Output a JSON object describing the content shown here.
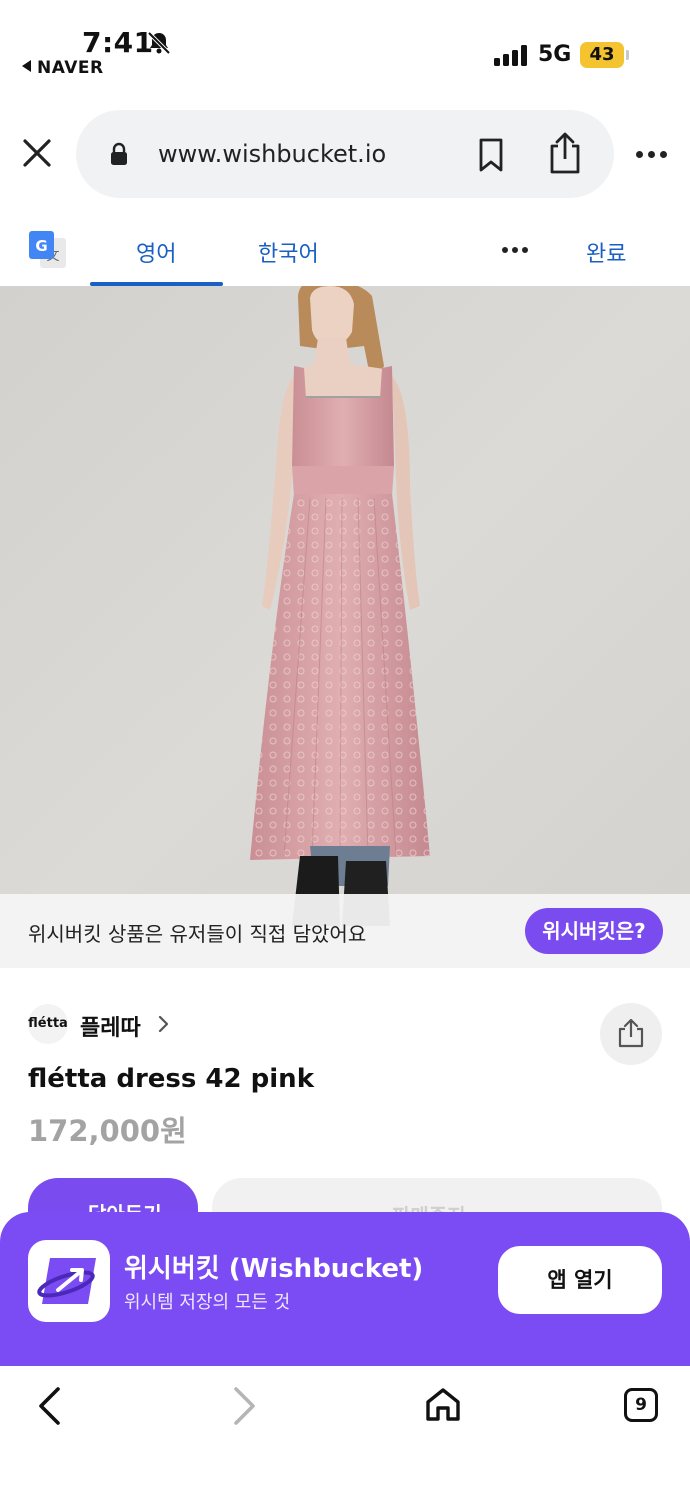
{
  "status_bar": {
    "time": "7:41",
    "back_app": "NAVER",
    "network": "5G",
    "battery": "43",
    "colors": {
      "battery": "#f4c430"
    }
  },
  "browser": {
    "url": "www.wishbucket.io",
    "icons": [
      "close-icon",
      "lock-icon",
      "bookmark-icon",
      "share-icon",
      "more-icon"
    ]
  },
  "translate": {
    "source_lang": "영어",
    "target_lang": "한국어",
    "done_label": "완료",
    "active_tab": "source"
  },
  "product_image": {
    "info_text": "위시버킷 상품은 유저들이 직접 담았어요",
    "what_button": "위시버킷은?"
  },
  "product": {
    "brand_logo_text": "flétta",
    "brand_name": "플레따",
    "title": "flétta dress 42 pink",
    "price": "172,000원",
    "primary_cta": "담아두기",
    "secondary_cta": "판매중지"
  },
  "app_banner": {
    "name": "위시버킷 (Wishbucket)",
    "description": "위시템 저장의 모든 것",
    "open_label": "앱 열기",
    "colors": {
      "background": "#7b4cf3"
    }
  },
  "bottom_nav": {
    "tab_count": "9"
  },
  "colors": {
    "accent": "#7a4cf0",
    "link_blue": "#1a5fc4",
    "dress_pink": "#d9a0a5"
  }
}
